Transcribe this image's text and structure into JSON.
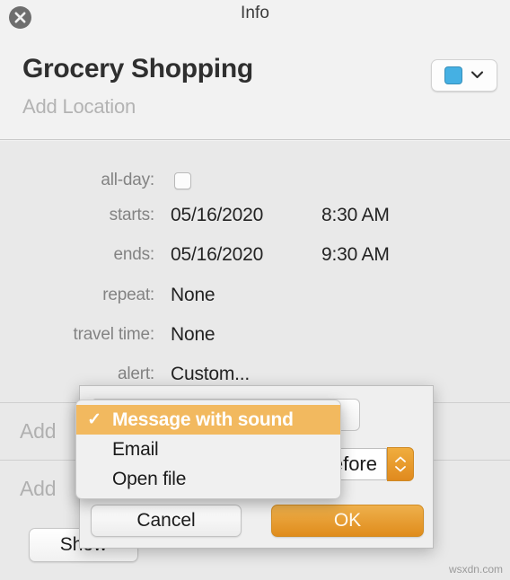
{
  "window": {
    "title": "Info",
    "close_icon": "close-circle-icon"
  },
  "header": {
    "event_title": "Grocery Shopping",
    "location_placeholder": "Add Location",
    "calendar_color": "#45b0e3",
    "chevron_icon": "chevron-down-icon"
  },
  "form": {
    "rows": [
      {
        "label": "all-day:",
        "type": "checkbox",
        "checked": false
      },
      {
        "label": "starts:",
        "date": "05/16/2020",
        "time": "8:30 AM"
      },
      {
        "label": "ends:",
        "date": "05/16/2020",
        "time": "9:30 AM"
      },
      {
        "label": "repeat:",
        "value": "None"
      },
      {
        "label": "travel time:",
        "value": "None"
      },
      {
        "label": "alert:",
        "value": "Custom..."
      }
    ],
    "add_rows": [
      {
        "label": "Add"
      },
      {
        "label": "Add"
      }
    ],
    "show_button": "Show"
  },
  "alert_dialog": {
    "offset_value": "Before",
    "stepper_icon": "stepper-up-down-icon",
    "cancel_label": "Cancel",
    "ok_label": "OK",
    "accent_color": "#e08c1c"
  },
  "alert_menu": {
    "check_glyph": "✓",
    "items": [
      {
        "label": "Message with sound",
        "selected": true
      },
      {
        "label": "Email",
        "selected": false
      },
      {
        "label": "Open file",
        "selected": false
      }
    ],
    "highlight_color": "#f2b95f"
  },
  "watermark": "wsxdn.com"
}
